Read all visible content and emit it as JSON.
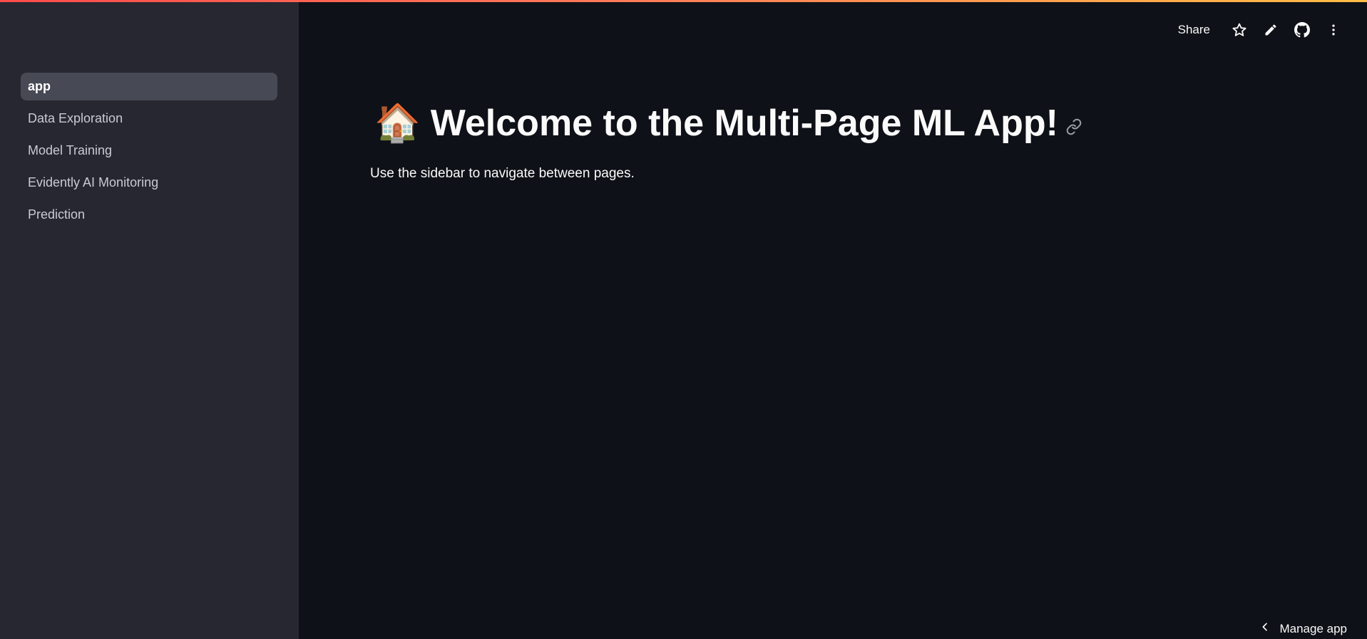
{
  "sidebar": {
    "items": [
      {
        "label": "app",
        "active": true
      },
      {
        "label": "Data Exploration",
        "active": false
      },
      {
        "label": "Model Training",
        "active": false
      },
      {
        "label": "Evidently AI Monitoring",
        "active": false
      },
      {
        "label": "Prediction",
        "active": false
      }
    ]
  },
  "header": {
    "share_label": "Share",
    "icons": [
      "star-icon",
      "pencil-icon",
      "github-icon",
      "more-vertical-icon"
    ]
  },
  "main": {
    "title_emoji": "🏠",
    "title": "Welcome to the Multi-Page ML App!",
    "subtitle": "Use the sidebar to navigate between pages."
  },
  "footer": {
    "manage_label": "Manage app"
  },
  "colors": {
    "sidebar_bg": "#262730",
    "main_bg": "#0e1117",
    "active_item_bg": "#474955",
    "accent_gradient_start": "#ff4b4b",
    "accent_gradient_end": "#ffbd45"
  }
}
